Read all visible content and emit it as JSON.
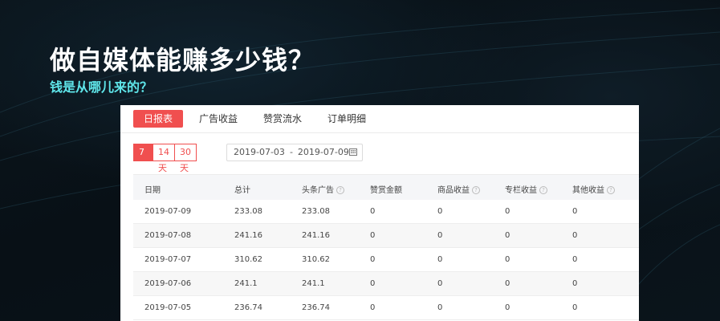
{
  "headline": "做自媒体能赚多少钱？",
  "subheadline": "钱是从哪儿来的？",
  "tabs": [
    "日报表",
    "广告收益",
    "赞赏流水",
    "订单明细"
  ],
  "range_buttons": [
    "7天",
    "14天",
    "30天"
  ],
  "date_range": {
    "start": "2019-07-03",
    "separator": "-",
    "end": "2019-07-09"
  },
  "columns": [
    "日期",
    "总计",
    "头条广告",
    "赞赏金额",
    "商品收益",
    "专栏收益",
    "其他收益"
  ],
  "help_glyph": "?",
  "rows": [
    [
      "2019-07-09",
      "233.08",
      "233.08",
      "0",
      "0",
      "0",
      "0"
    ],
    [
      "2019-07-08",
      "241.16",
      "241.16",
      "0",
      "0",
      "0",
      "0"
    ],
    [
      "2019-07-07",
      "310.62",
      "310.62",
      "0",
      "0",
      "0",
      "0"
    ],
    [
      "2019-07-06",
      "241.1",
      "241.1",
      "0",
      "0",
      "0",
      "0"
    ],
    [
      "2019-07-05",
      "236.74",
      "236.74",
      "0",
      "0",
      "0",
      "0"
    ]
  ],
  "colors": {
    "accent": "#f04f4f",
    "subheadline": "#5fe6ea"
  }
}
